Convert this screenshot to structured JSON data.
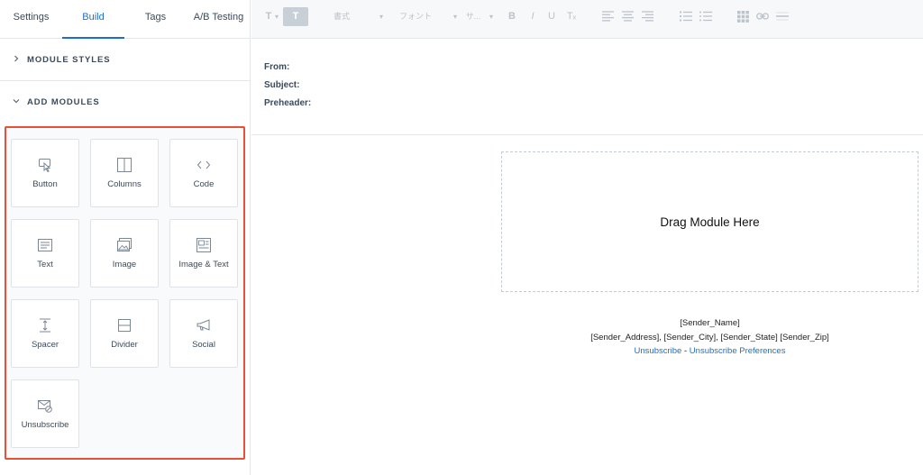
{
  "tabs": {
    "settings": "Settings",
    "build": "Build",
    "tags": "Tags",
    "ab_testing": "A/B Testing"
  },
  "sections": {
    "module_styles": "MODULE STYLES",
    "add_modules": "ADD MODULES"
  },
  "modules": {
    "button": "Button",
    "columns": "Columns",
    "code": "Code",
    "text": "Text",
    "image": "Image",
    "image_text": "Image & Text",
    "spacer": "Spacer",
    "divider": "Divider",
    "social": "Social",
    "unsubscribe": "Unsubscribe"
  },
  "toolbar": {
    "style_label": "書式",
    "font_label": "フォント",
    "size_label": "サ...",
    "dropdown_arrow": "▾",
    "bold": "B",
    "italic": "I",
    "underline": "U",
    "text_color": "T",
    "format_t": "T",
    "clear_format": "Tₓ"
  },
  "email_header": {
    "from": "From:",
    "subject": "Subject:",
    "preheader": "Preheader:"
  },
  "canvas": {
    "drop_text": "Drag Module Here",
    "sender_name": "[Sender_Name]",
    "sender_address": "[Sender_Address], [Sender_City], [Sender_State] [Sender_Zip]",
    "unsubscribe": "Unsubscribe",
    "separator": " - ",
    "unsubscribe_prefs": "Unsubscribe Preferences"
  },
  "colors": {
    "accent": "#1e6fc8",
    "highlight_border": "#e8503a"
  }
}
